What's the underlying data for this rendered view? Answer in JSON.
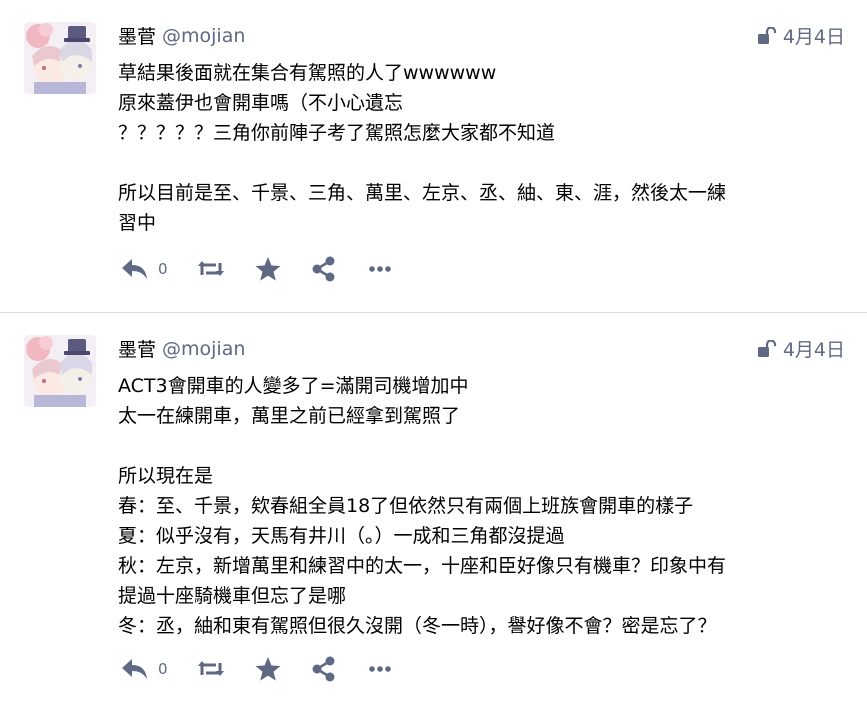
{
  "posts": [
    {
      "author": {
        "display_name": "墨菅",
        "handle": "@mojian"
      },
      "date": "4月4日",
      "visibility_icon": "unlock-icon",
      "paragraphs": [
        "草結果後面就在集合有駕照的人了wwwwww\n原來蓋伊也會開車嗎（不小心遺忘\n？？？？？三角你前陣子考了駕照怎麼大家都不知道",
        "所以目前是至、千景、三角、萬里、左京、丞、紬、東、涯，然後太一練\n習中"
      ],
      "reply_count": "0"
    },
    {
      "author": {
        "display_name": "墨菅",
        "handle": "@mojian"
      },
      "date": "4月4日",
      "visibility_icon": "unlock-icon",
      "paragraphs": [
        "ACT3會開車的人變多了=滿開司機增加中\n太一在練開車，萬里之前已經拿到駕照了",
        "所以現在是\n春：至、千景，欸春組全員18了但依然只有兩個上班族會開車的樣子\n夏：似乎沒有，天馬有井川（。）一成和三角都沒提過\n秋：左京，新增萬里和練習中的太一，十座和臣好像只有機車？印象中有\n提過十座騎機車但忘了是哪\n冬：丞，紬和東有駕照但很久沒開（冬一時），譽好像不會？密是忘了？"
      ],
      "reply_count": "0"
    }
  ],
  "colors": {
    "text": "#000000",
    "muted": "#606984",
    "divider": "#d9dde3",
    "icon": "#606984"
  },
  "icons": [
    "reply-icon",
    "boost-icon",
    "favourite-icon",
    "share-icon",
    "more-icon",
    "unlock-icon"
  ]
}
